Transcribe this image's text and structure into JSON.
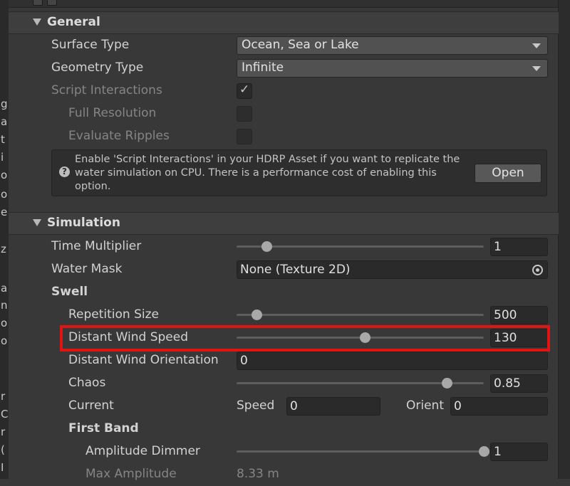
{
  "general": {
    "title": "General",
    "surface_type": {
      "label": "Surface Type",
      "value": "Ocean, Sea or Lake"
    },
    "geometry_type": {
      "label": "Geometry Type",
      "value": "Infinite"
    },
    "script_interactions": {
      "label": "Script Interactions",
      "checked": true
    },
    "full_resolution": {
      "label": "Full Resolution",
      "checked": false
    },
    "evaluate_ripples": {
      "label": "Evaluate Ripples",
      "checked": false
    },
    "help": {
      "text": "Enable 'Script Interactions' in your HDRP Asset if you want to replicate the water simulation on CPU. There is a performance cost of enabling this option.",
      "button_label": "Open"
    }
  },
  "simulation": {
    "title": "Simulation",
    "time_multiplier": {
      "label": "Time Multiplier",
      "value": "1",
      "slider_fraction": 0.12
    },
    "water_mask": {
      "label": "Water Mask",
      "value": "None (Texture 2D)"
    },
    "swell": {
      "label": "Swell",
      "repetition_size": {
        "label": "Repetition Size",
        "value": "500",
        "slider_fraction": 0.08
      },
      "distant_wind_speed": {
        "label": "Distant Wind Speed",
        "value": "130",
        "slider_fraction": 0.52
      },
      "distant_wind_orientation": {
        "label": "Distant Wind Orientation",
        "value": "0"
      },
      "chaos": {
        "label": "Chaos",
        "value": "0.85",
        "slider_fraction": 0.85
      },
      "current": {
        "label": "Current",
        "speed_label": "Speed",
        "speed_value": "0",
        "orient_label": "Orient",
        "orient_value": "0"
      },
      "first_band": {
        "label": "First Band",
        "amplitude_dimmer": {
          "label": "Amplitude Dimmer",
          "value": "1",
          "slider_fraction": 1.0
        },
        "max_amplitude": {
          "label": "Max Amplitude",
          "value": "8.33 m"
        }
      }
    }
  },
  "left_strip_glyphs": [
    "g",
    "a",
    "t",
    "i",
    "o",
    "o",
    "e",
    "z",
    "a",
    "n",
    "o",
    "o",
    "r",
    "C",
    "r",
    "(",
    "I"
  ],
  "colors": {
    "highlight": "#e11414",
    "panel_bg": "#383838"
  }
}
